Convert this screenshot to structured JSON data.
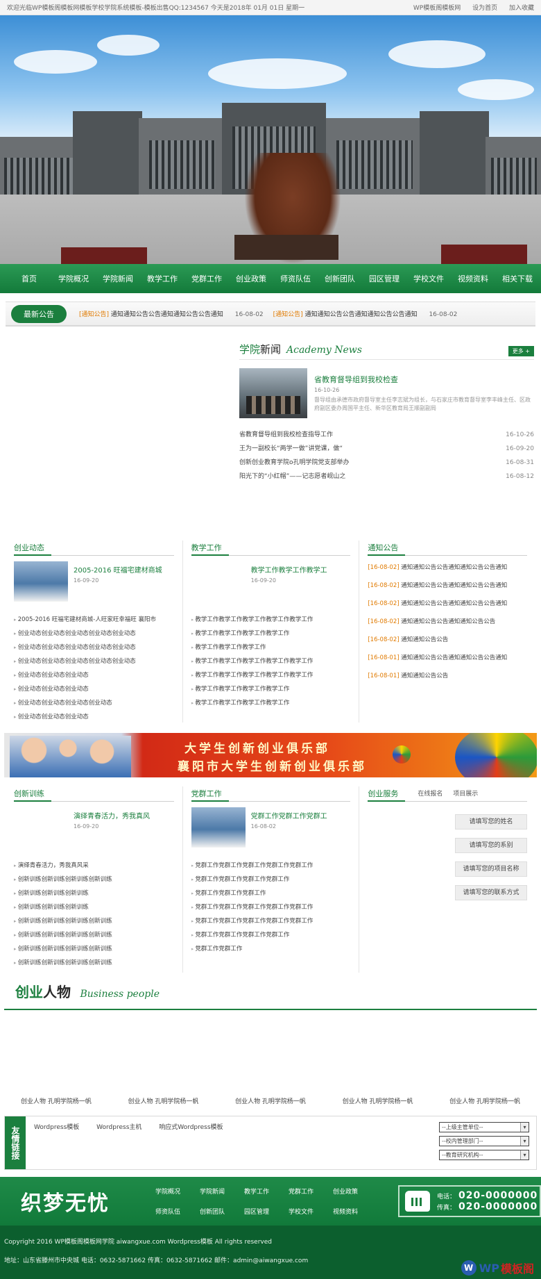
{
  "topbar": {
    "welcome": "欢迎光临WP模板阁模板网模板学校学院系统模板-模板出售QQ:1234567 今天是2018年 01月 01日 星期一",
    "links": [
      "WP模板阁模板网",
      "设为首页",
      "加入收藏"
    ]
  },
  "nav": [
    "首页",
    "学院概况",
    "学院新闻",
    "教学工作",
    "党群工作",
    "创业政策",
    "师资队伍",
    "创新团队",
    "园区管理",
    "学校文件",
    "视频资料",
    "相关下载"
  ],
  "notice": {
    "badge": "最新公告",
    "items": [
      {
        "tag": "[通知公告]",
        "text": "通知通知公告公告通知通知公告公告通知",
        "date": "16-08-02"
      },
      {
        "tag": "[通知公告]",
        "text": "通知通知公告公告通知通知公告公告通知",
        "date": "16-08-02"
      }
    ]
  },
  "academy": {
    "title_a": "学院",
    "title_b": "新闻",
    "title_en": "Academy News",
    "more": "更多 +",
    "feature": {
      "title": "省教育督导组到我校检查",
      "date": "16-10-26",
      "summary": "督导组由承德市政府督导室主任李志斌为组长，与石家庄市教育督导室李丰峰主任、区政府副区委办周国平主任、新华区教育局王顺副副局"
    },
    "list": [
      {
        "title": "省教育督导组到我校检查指导工作",
        "date": "16-10-26"
      },
      {
        "title": "王为一副校长“两学一做”讲党课，做“",
        "date": "16-09-20"
      },
      {
        "title": "创新创业教育学院o孔明学院党支部举办",
        "date": "16-08-31"
      },
      {
        "title": "阳光下的“小红帽”——记志愿者岘山之",
        "date": "16-08-12"
      }
    ]
  },
  "chuangye": {
    "title": "创业动态",
    "top": {
      "title": "2005-2016 旺福宅建材商城",
      "date": "16-09-20"
    },
    "list": [
      "2005-2016 旺福宅建材商城-人旺家旺幸福旺 襄阳市",
      "创业动态创业动态创业动态创业动态创业动态",
      "创业动态创业动态创业动态创业动态创业动态",
      "创业动态创业动态创业动态创业动态创业动态",
      "创业动态创业动态创业动态",
      "创业动态创业动态创业动态",
      "创业动态创业动态创业动态创业动态",
      "创业动态创业动态创业动态"
    ]
  },
  "jiaoxue": {
    "title": "教学工作",
    "top": {
      "title": "教学工作教学工作教学工",
      "date": "16-09-20"
    },
    "list": [
      "教学工作教学工作教学工作教学工作教学工作",
      "教学工作教学工作教学工作教学工作",
      "教学工作教学工作教学工作",
      "教学工作教学工作教学工作教学工作教学工作",
      "教学工作教学工作教学工作教学工作教学工作",
      "教学工作教学工作教学工作教学工作",
      "教学工作教学工作教学工作教学工作"
    ]
  },
  "tongzhi": {
    "title": "通知公告",
    "list": [
      {
        "tag": "[16-08-02]",
        "text": "通知通知公告公告通知通知公告公告通知"
      },
      {
        "tag": "[16-08-02]",
        "text": "通知通知公告公告通知通知公告公告通知"
      },
      {
        "tag": "[16-08-02]",
        "text": "通知通知公告公告通知通知公告公告通知"
      },
      {
        "tag": "[16-08-02]",
        "text": "通知通知公告公告通知通知公告公告"
      },
      {
        "tag": "[16-08-02]",
        "text": "通知通知公告公告"
      },
      {
        "tag": "[16-08-01]",
        "text": "通知通知公告公告通知通知公告公告通知"
      },
      {
        "tag": "[16-08-01]",
        "text": "通知通知公告公告"
      }
    ]
  },
  "club": {
    "line1": "大学生创新创业俱乐部",
    "line2": "襄阳市大学生创新创业俱乐部"
  },
  "xunlian": {
    "title": "创新训练",
    "top": {
      "title": "演绎青春活力，秀我真风",
      "date": "16-09-20"
    },
    "list": [
      "演绎青春活力，秀我真风采",
      "创新训练创新训练创新训练创新训练",
      "创新训练创新训练创新训练",
      "创新训练创新训练创新训练",
      "创新训练创新训练创新训练创新训练",
      "创新训练创新训练创新训练创新训练",
      "创新训练创新训练创新训练创新训练",
      "创新训练创新训练创新训练创新训练"
    ]
  },
  "dangqun": {
    "title": "党群工作",
    "top": {
      "title": "党群工作党群工作党群工",
      "date": "16-08-02"
    },
    "list": [
      "党群工作党群工作党群工作党群工作党群工作",
      "党群工作党群工作党群工作党群工作",
      "党群工作党群工作党群工作",
      "党群工作党群工作党群工作党群工作党群工作",
      "党群工作党群工作党群工作党群工作党群工作",
      "党群工作党群工作党群工作党群工作",
      "党群工作党群工作"
    ]
  },
  "service": {
    "title": "创业服务",
    "tabs": [
      "在线报名",
      "项目展示"
    ],
    "fields": [
      "请填写您的姓名",
      "请填写您的系别",
      "请填写您的项目名称",
      "请填写您的联系方式"
    ]
  },
  "people": {
    "title_a": "创业",
    "title_b": "人物",
    "title_en": "Business people",
    "items": [
      "创业人物 孔明学院杨一帆",
      "创业人物 孔明学院杨一帆",
      "创业人物 孔明学院杨一帆",
      "创业人物 孔明学院杨一帆",
      "创业人物 孔明学院杨一帆"
    ]
  },
  "friend": {
    "label": "友情链接",
    "links": [
      "Wordpress模板",
      "Wordpress主机",
      "响应式Wordpress模板"
    ],
    "selects": [
      "--上级主管单位--",
      "--校内管理部门--",
      "--教育研究机构--"
    ]
  },
  "footer": {
    "logo": "织梦无忧",
    "nav": [
      "学院概况",
      "学院新闻",
      "教学工作",
      "党群工作",
      "创业政策",
      "师资队伍",
      "创新团队",
      "园区管理",
      "学校文件",
      "视频资料"
    ],
    "tel_label": "电话：",
    "tel": "020-0000000",
    "fax_label": "传真：",
    "fax": "020-0000000",
    "copyright": "Copyright 2016 WP模板阁模板网学院 aiwangxue.com Wordpress模板 All rights reserved",
    "address": "地址：山东省滕州市中央城 电话：0632-5871662 传真：0632-5871662 邮件：admin@aiwangxue.com",
    "wp_a": "WP",
    "wp_b": "模板阁"
  }
}
